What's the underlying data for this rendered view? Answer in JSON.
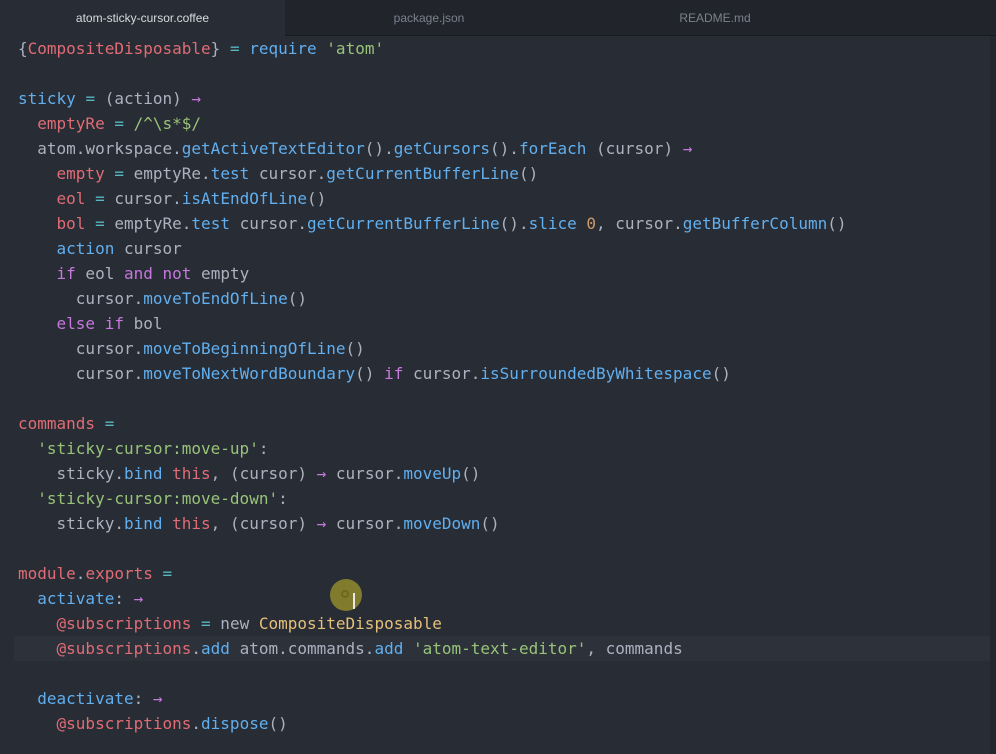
{
  "tabs": [
    {
      "label": "atom-sticky-cursor.coffee",
      "active": true
    },
    {
      "label": "package.json",
      "active": false
    },
    {
      "label": "README.md",
      "active": false
    }
  ],
  "code_lines": [
    [
      [
        "p",
        "{"
      ],
      [
        "v",
        "CompositeDisposable"
      ],
      [
        "p",
        "} "
      ],
      [
        "o",
        "="
      ],
      [
        "p",
        " "
      ],
      [
        "f",
        "require"
      ],
      [
        "p",
        " "
      ],
      [
        "s",
        "'atom'"
      ]
    ],
    [],
    [
      [
        "f",
        "sticky"
      ],
      [
        "p",
        " "
      ],
      [
        "o",
        "="
      ],
      [
        "p",
        " (action) "
      ],
      [
        "k",
        "→"
      ]
    ],
    [
      [
        "p",
        "  "
      ],
      [
        "v",
        "emptyRe"
      ],
      [
        "p",
        " "
      ],
      [
        "o",
        "="
      ],
      [
        "p",
        " "
      ],
      [
        "s",
        "/^\\s*$/"
      ]
    ],
    [
      [
        "p",
        "  atom.workspace."
      ],
      [
        "f",
        "getActiveTextEditor"
      ],
      [
        "p",
        "()."
      ],
      [
        "f",
        "getCursors"
      ],
      [
        "p",
        "()."
      ],
      [
        "f",
        "forEach"
      ],
      [
        "p",
        " (cursor) "
      ],
      [
        "k",
        "→"
      ]
    ],
    [
      [
        "p",
        "    "
      ],
      [
        "v",
        "empty"
      ],
      [
        "p",
        " "
      ],
      [
        "o",
        "="
      ],
      [
        "p",
        " emptyRe."
      ],
      [
        "f",
        "test"
      ],
      [
        "p",
        " cursor."
      ],
      [
        "f",
        "getCurrentBufferLine"
      ],
      [
        "p",
        "()"
      ]
    ],
    [
      [
        "p",
        "    "
      ],
      [
        "v",
        "eol"
      ],
      [
        "p",
        " "
      ],
      [
        "o",
        "="
      ],
      [
        "p",
        " cursor."
      ],
      [
        "f",
        "isAtEndOfLine"
      ],
      [
        "p",
        "()"
      ]
    ],
    [
      [
        "p",
        "    "
      ],
      [
        "v",
        "bol"
      ],
      [
        "p",
        " "
      ],
      [
        "o",
        "="
      ],
      [
        "p",
        " emptyRe."
      ],
      [
        "f",
        "test"
      ],
      [
        "p",
        " cursor."
      ],
      [
        "f",
        "getCurrentBufferLine"
      ],
      [
        "p",
        "()."
      ],
      [
        "f",
        "slice"
      ],
      [
        "p",
        " "
      ],
      [
        "n",
        "0"
      ],
      [
        "p",
        ", cursor."
      ],
      [
        "f",
        "getBufferColumn"
      ],
      [
        "p",
        "()"
      ]
    ],
    [
      [
        "p",
        "    "
      ],
      [
        "f",
        "action"
      ],
      [
        "p",
        " cursor"
      ]
    ],
    [
      [
        "p",
        "    "
      ],
      [
        "k",
        "if"
      ],
      [
        "p",
        " eol "
      ],
      [
        "k",
        "and"
      ],
      [
        "p",
        " "
      ],
      [
        "k",
        "not"
      ],
      [
        "p",
        " empty"
      ]
    ],
    [
      [
        "p",
        "      cursor."
      ],
      [
        "f",
        "moveToEndOfLine"
      ],
      [
        "p",
        "()"
      ]
    ],
    [
      [
        "p",
        "    "
      ],
      [
        "k",
        "else if"
      ],
      [
        "p",
        " bol"
      ]
    ],
    [
      [
        "p",
        "      cursor."
      ],
      [
        "f",
        "moveToBeginningOfLine"
      ],
      [
        "p",
        "()"
      ]
    ],
    [
      [
        "p",
        "      cursor."
      ],
      [
        "f",
        "moveToNextWordBoundary"
      ],
      [
        "p",
        "() "
      ],
      [
        "k",
        "if"
      ],
      [
        "p",
        " cursor."
      ],
      [
        "f",
        "isSurroundedByWhitespace"
      ],
      [
        "p",
        "()"
      ]
    ],
    [],
    [
      [
        "v",
        "commands"
      ],
      [
        "p",
        " "
      ],
      [
        "o",
        "="
      ]
    ],
    [
      [
        "p",
        "  "
      ],
      [
        "s",
        "'sticky-cursor:move-up'"
      ],
      [
        "p",
        ":"
      ]
    ],
    [
      [
        "p",
        "    sticky."
      ],
      [
        "f",
        "bind"
      ],
      [
        "p",
        " "
      ],
      [
        "v",
        "this"
      ],
      [
        "p",
        ", (cursor) "
      ],
      [
        "k",
        "→"
      ],
      [
        "p",
        " cursor."
      ],
      [
        "f",
        "moveUp"
      ],
      [
        "p",
        "()"
      ]
    ],
    [
      [
        "p",
        "  "
      ],
      [
        "s",
        "'sticky-cursor:move-down'"
      ],
      [
        "p",
        ":"
      ]
    ],
    [
      [
        "p",
        "    sticky."
      ],
      [
        "f",
        "bind"
      ],
      [
        "p",
        " "
      ],
      [
        "v",
        "this"
      ],
      [
        "p",
        ", (cursor) "
      ],
      [
        "k",
        "→"
      ],
      [
        "p",
        " cursor."
      ],
      [
        "f",
        "moveDown"
      ],
      [
        "p",
        "()"
      ]
    ],
    [],
    [
      [
        "v",
        "module"
      ],
      [
        "p",
        "."
      ],
      [
        "v",
        "exports"
      ],
      [
        "p",
        " "
      ],
      [
        "o",
        "="
      ]
    ],
    [
      [
        "p",
        "  "
      ],
      [
        "f",
        "activate"
      ],
      [
        "p",
        ": "
      ],
      [
        "k",
        "→"
      ]
    ],
    [
      [
        "p",
        "    "
      ],
      [
        "v",
        "@subscriptions"
      ],
      [
        "p",
        " "
      ],
      [
        "o",
        "="
      ],
      [
        "p",
        " new "
      ],
      [
        "c",
        "CompositeDisposable"
      ]
    ],
    [
      [
        "p",
        "    "
      ],
      [
        "v",
        "@subscriptions"
      ],
      [
        "p",
        "."
      ],
      [
        "f",
        "add"
      ],
      [
        "p",
        " atom.commands."
      ],
      [
        "f",
        "add"
      ],
      [
        "p",
        " "
      ],
      [
        "s",
        "'atom-text-editor'"
      ],
      [
        "p",
        ", commands"
      ]
    ],
    [],
    [
      [
        "p",
        "  "
      ],
      [
        "f",
        "deactivate"
      ],
      [
        "p",
        ": "
      ],
      [
        "k",
        "→"
      ]
    ],
    [
      [
        "p",
        "    "
      ],
      [
        "v",
        "@subscriptions"
      ],
      [
        "p",
        "."
      ],
      [
        "f",
        "dispose"
      ],
      [
        "p",
        "()"
      ]
    ]
  ],
  "colors": {
    "background": "#282c34",
    "keyword": "#c678dd",
    "variable": "#e06c75",
    "function": "#61afef",
    "string": "#98c379",
    "number": "#d19a66",
    "class": "#e5c07b"
  }
}
